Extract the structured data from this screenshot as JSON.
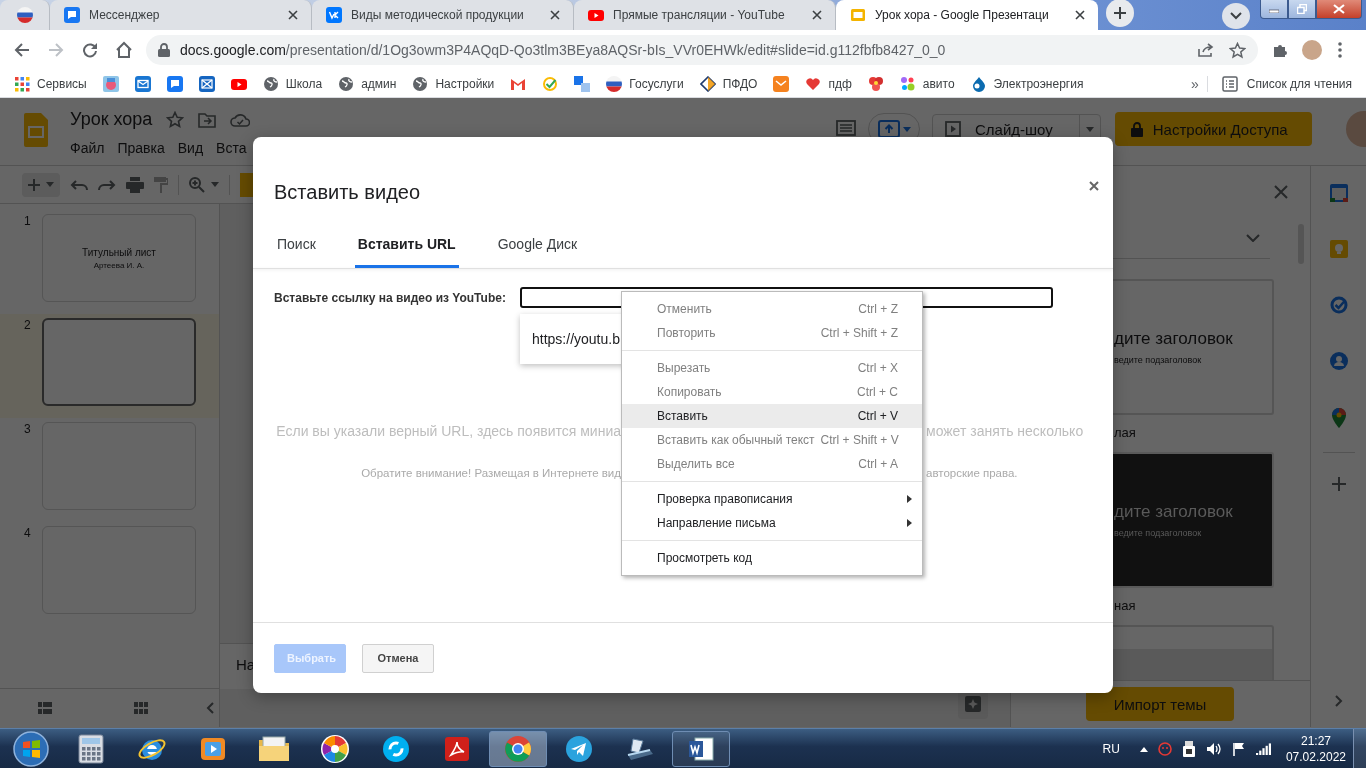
{
  "browser": {
    "tabs": [
      {
        "kind": "pinned",
        "selected": false
      },
      {
        "kind": "page",
        "title": "Мессенджер",
        "selected": false
      },
      {
        "kind": "page",
        "title": "Виды методической продукции",
        "selected": false
      },
      {
        "kind": "page",
        "title": "Прямые трансляции - YouTube",
        "selected": false
      },
      {
        "kind": "page",
        "title": "Урок хора - Google Презентаци",
        "selected": true
      }
    ],
    "address": {
      "host": "docs.google.com",
      "path": "/presentation/d/1Og3owm3P4AQqD-Qo3tlm3BEya8AQSr-bIs_VVr0EHWk/edit#slide=id.g112fbfb8427_0_0"
    },
    "bookmarks": [
      {
        "kind": "link",
        "label": "Сервисы"
      },
      {
        "kind": "icon"
      },
      {
        "kind": "icon"
      },
      {
        "kind": "icon"
      },
      {
        "kind": "icon"
      },
      {
        "kind": "icon"
      },
      {
        "kind": "link",
        "label": "Школа"
      },
      {
        "kind": "link",
        "label": "админ"
      },
      {
        "kind": "link",
        "label": "Настройки"
      },
      {
        "kind": "icon"
      },
      {
        "kind": "icon"
      },
      {
        "kind": "icon"
      },
      {
        "kind": "link",
        "label": "Госуслуги"
      },
      {
        "kind": "link",
        "label": "ПФДО"
      },
      {
        "kind": "icon"
      },
      {
        "kind": "link",
        "label": "пдф"
      },
      {
        "kind": "icon"
      },
      {
        "kind": "link",
        "label": "авито"
      },
      {
        "kind": "link",
        "label": "Электроэнергия"
      }
    ],
    "overflow": "»",
    "reading_list": "Список для чтения"
  },
  "slides": {
    "title": "Урок хора",
    "menu": [
      "Файл",
      "Правка",
      "Вид",
      "Вста"
    ],
    "slideshow": "Слайд-шоу",
    "share": "Настройки Доступа",
    "filmstrip": [
      {
        "number": "1",
        "title": "Титульный лист",
        "subtitle": "Артеева И. А.",
        "selected": false
      },
      {
        "number": "2",
        "selected": true
      },
      {
        "number": "3",
        "selected": false
      },
      {
        "number": "4",
        "selected": false
      }
    ],
    "notes": "На",
    "themes": {
      "items": [
        {
          "kind": "light",
          "title": "дите заголовок",
          "subtitle": "ведите подзаголовок",
          "label": "лая"
        },
        {
          "kind": "dark",
          "title": "дите заголовок",
          "subtitle": "ведите подзаголовок",
          "label": "ная"
        },
        {
          "kind": "light"
        }
      ],
      "import_button": "Импорт темы"
    }
  },
  "dialog": {
    "title": "Вставить видео",
    "tabs": [
      {
        "label": "Поиск",
        "selected": false
      },
      {
        "label": "Вставить URL",
        "selected": true
      },
      {
        "label": "Google Диск",
        "selected": false
      }
    ],
    "url_label": "Вставьте ссылку на видео из YouTube:",
    "suggestion": "https://youtu.b",
    "hint": [
      "Если вы указали верный URL, здесь появится миниа",
      "может занять несколько"
    ],
    "note": [
      "Обратите внимание! Размещая в Интернете вид",
      "авторские права."
    ],
    "buttons": [
      {
        "label": "Выбрать",
        "kind": "primary",
        "disabled": true
      },
      {
        "label": "Отмена",
        "kind": "secondary",
        "disabled": false
      }
    ]
  },
  "context_menu": {
    "groups": [
      [
        {
          "label": "Отменить",
          "shortcut": "Ctrl + Z",
          "disabled": true,
          "highlighted": false,
          "submenu": false
        },
        {
          "label": "Повторить",
          "shortcut": "Ctrl + Shift + Z",
          "disabled": true,
          "highlighted": false,
          "submenu": false
        }
      ],
      [
        {
          "label": "Вырезать",
          "shortcut": "Ctrl + X",
          "disabled": true,
          "highlighted": false,
          "submenu": false
        },
        {
          "label": "Копировать",
          "shortcut": "Ctrl + C",
          "disabled": true,
          "highlighted": false,
          "submenu": false
        },
        {
          "label": "Вставить",
          "shortcut": "Ctrl + V",
          "disabled": false,
          "highlighted": true,
          "submenu": false
        },
        {
          "label": "Вставить как обычный текст",
          "shortcut": "Ctrl + Shift + V",
          "disabled": true,
          "highlighted": false,
          "submenu": false
        },
        {
          "label": "Выделить все",
          "shortcut": "Ctrl + A",
          "disabled": true,
          "highlighted": false,
          "submenu": false
        }
      ],
      [
        {
          "label": "Проверка правописания",
          "disabled": false,
          "highlighted": false,
          "submenu": true
        },
        {
          "label": "Направление письма",
          "disabled": false,
          "highlighted": false,
          "submenu": true
        }
      ],
      [
        {
          "label": "Просмотреть код",
          "disabled": false,
          "highlighted": false,
          "submenu": false
        }
      ]
    ]
  },
  "taskbar": {
    "items": [
      {
        "kind": "calculator",
        "selected": false,
        "running": false
      },
      {
        "kind": "ie",
        "selected": false,
        "running": false
      },
      {
        "kind": "media",
        "selected": false,
        "running": false
      },
      {
        "kind": "folder",
        "selected": false,
        "running": false
      },
      {
        "kind": "pinwheel",
        "selected": false,
        "running": false
      },
      {
        "kind": "skype",
        "selected": false,
        "running": false
      },
      {
        "kind": "pdf",
        "selected": false,
        "running": false
      },
      {
        "kind": "chrome",
        "selected": true,
        "running": true
      },
      {
        "kind": "telegram",
        "selected": false,
        "running": false
      },
      {
        "kind": "scanner",
        "selected": false,
        "running": false
      },
      {
        "kind": "word",
        "selected": false,
        "running": true
      }
    ],
    "language": "RU",
    "time": "21:27",
    "date": "07.02.2022"
  }
}
